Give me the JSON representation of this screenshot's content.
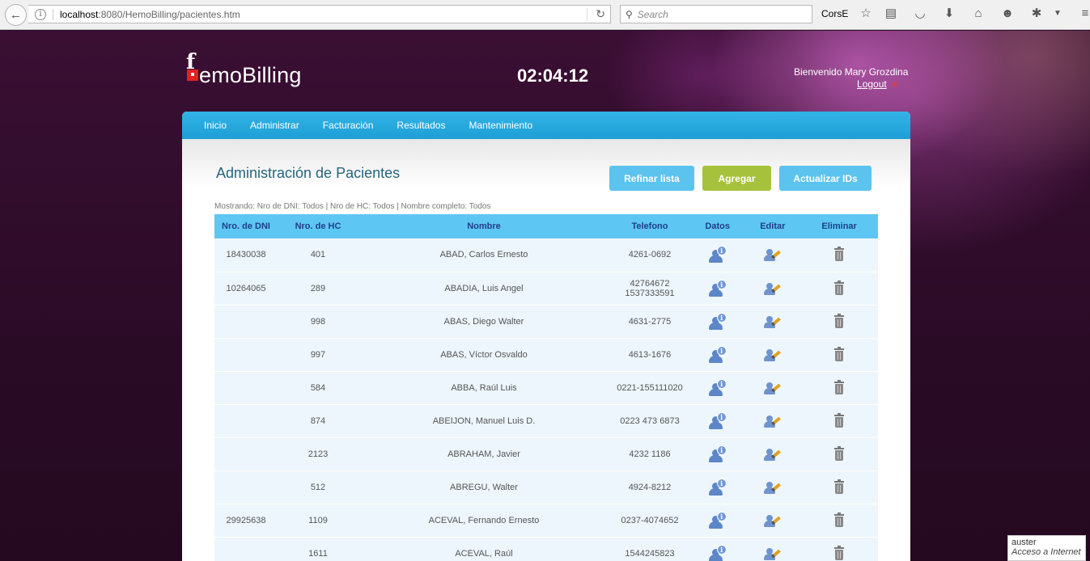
{
  "browser": {
    "url_host": "localhost",
    "url_path": ":8080/HemoBilling/pacientes.htm",
    "search_placeholder": "Search",
    "search_engine_label": "CorsE"
  },
  "header": {
    "logo_text": "emoBilling",
    "logo_letter": "f",
    "clock": "02:04:12",
    "welcome": "Bienvenido Mary Grozdina",
    "logout": "Logout",
    "logout_icon": "×"
  },
  "menu": {
    "items": [
      {
        "label": "Inicio"
      },
      {
        "label": "Administrar"
      },
      {
        "label": "Facturación"
      },
      {
        "label": "Resultados"
      },
      {
        "label": "Mantenimiento"
      }
    ]
  },
  "main": {
    "title": "Administración de Pacientes",
    "buttons": {
      "refine": "Refinar lista",
      "add": "Agregar",
      "update_ids": "Actualizar IDs"
    },
    "filter_text": "Mostrando: Nro de DNI: Todos | Nro de HC: Todos | Nombre completo: Todos"
  },
  "table": {
    "headers": {
      "dni": "Nro. de DNI",
      "hc": "Nro. de HC",
      "name": "Nombre",
      "phone": "Telefono",
      "data": "Datos",
      "edit": "Editar",
      "delete": "Eliminar"
    },
    "rows": [
      {
        "dni": "18430038",
        "hc": "401",
        "name": "ABAD, Carlos Ernesto",
        "phone": "4261-0692"
      },
      {
        "dni": "10264065",
        "hc": "289",
        "name": "ABADIA, Luis Angel",
        "phone": "42764672 1537333591"
      },
      {
        "dni": "",
        "hc": "998",
        "name": "ABAS, Diego Walter",
        "phone": "4631-2775"
      },
      {
        "dni": "",
        "hc": "997",
        "name": "ABAS, Víctor Osvaldo",
        "phone": "4613-1676"
      },
      {
        "dni": "",
        "hc": "584",
        "name": "ABBA, Raúl Luis",
        "phone": "0221-155111020"
      },
      {
        "dni": "",
        "hc": "874",
        "name": "ABEIJON, Manuel Luis D.",
        "phone": "0223 473 6873"
      },
      {
        "dni": "",
        "hc": "2123",
        "name": "ABRAHAM, Javier",
        "phone": "4232 1186"
      },
      {
        "dni": "",
        "hc": "512",
        "name": "ABREGU, Walter",
        "phone": "4924-8212"
      },
      {
        "dni": "29925638",
        "hc": "1109",
        "name": "ACEVAL, Fernando Ernesto",
        "phone": "0237-4074652"
      },
      {
        "dni": "",
        "hc": "1611",
        "name": "ACEVAL, Raúl",
        "phone": "1544245823"
      }
    ]
  },
  "status_popup": {
    "line1": "auster",
    "line2": "Acceso a Internet"
  }
}
